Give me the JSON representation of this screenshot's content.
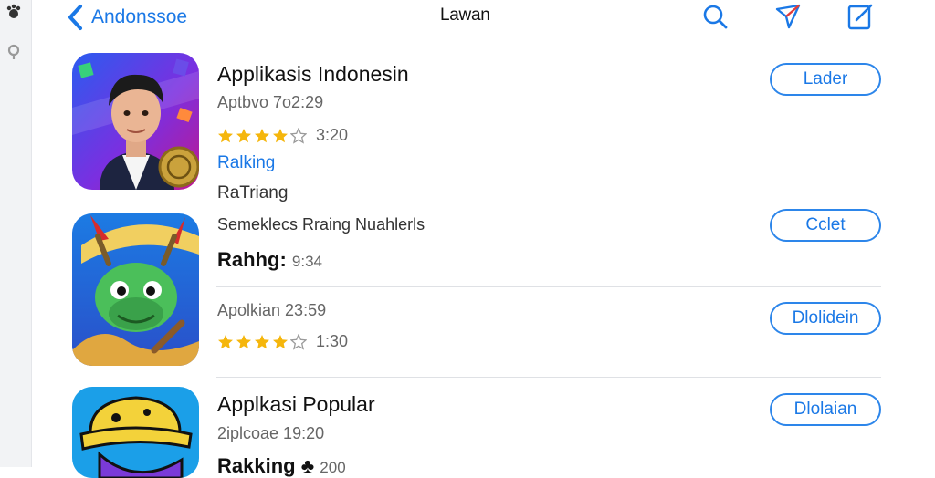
{
  "nav": {
    "back_label": "Andonssoe",
    "title": "Lawan"
  },
  "apps": [
    {
      "name": "Applikasis Indonesin",
      "subtitle": "Aptbvo 7o2:29",
      "rating_value": "3:20",
      "stars": 4,
      "link": "Ralking",
      "extra": "RaTriang",
      "button": "Lader"
    },
    {
      "line1": "Semeklecs Rraing Nuahlerls",
      "bold_label": "Rahhg:",
      "bold_value": "9:34",
      "button": "Cclet"
    },
    {
      "subtitle": "Apolkian 23:59",
      "rating_value": "1:30",
      "stars": 4,
      "button": "Dlolidein"
    },
    {
      "name": "Applkasi Popular",
      "subtitle": "2iplcoae 19:20",
      "bold_label": "Rakking",
      "bold_value": "200",
      "button": "Dlolaian"
    }
  ],
  "colors": {
    "accent": "#1a78e6",
    "star": "#f5b60c",
    "sidebar": "#f2f3f5"
  },
  "icons": [
    "chevron-left-icon",
    "search-icon",
    "send-icon",
    "compose-icon",
    "star-icon"
  ]
}
